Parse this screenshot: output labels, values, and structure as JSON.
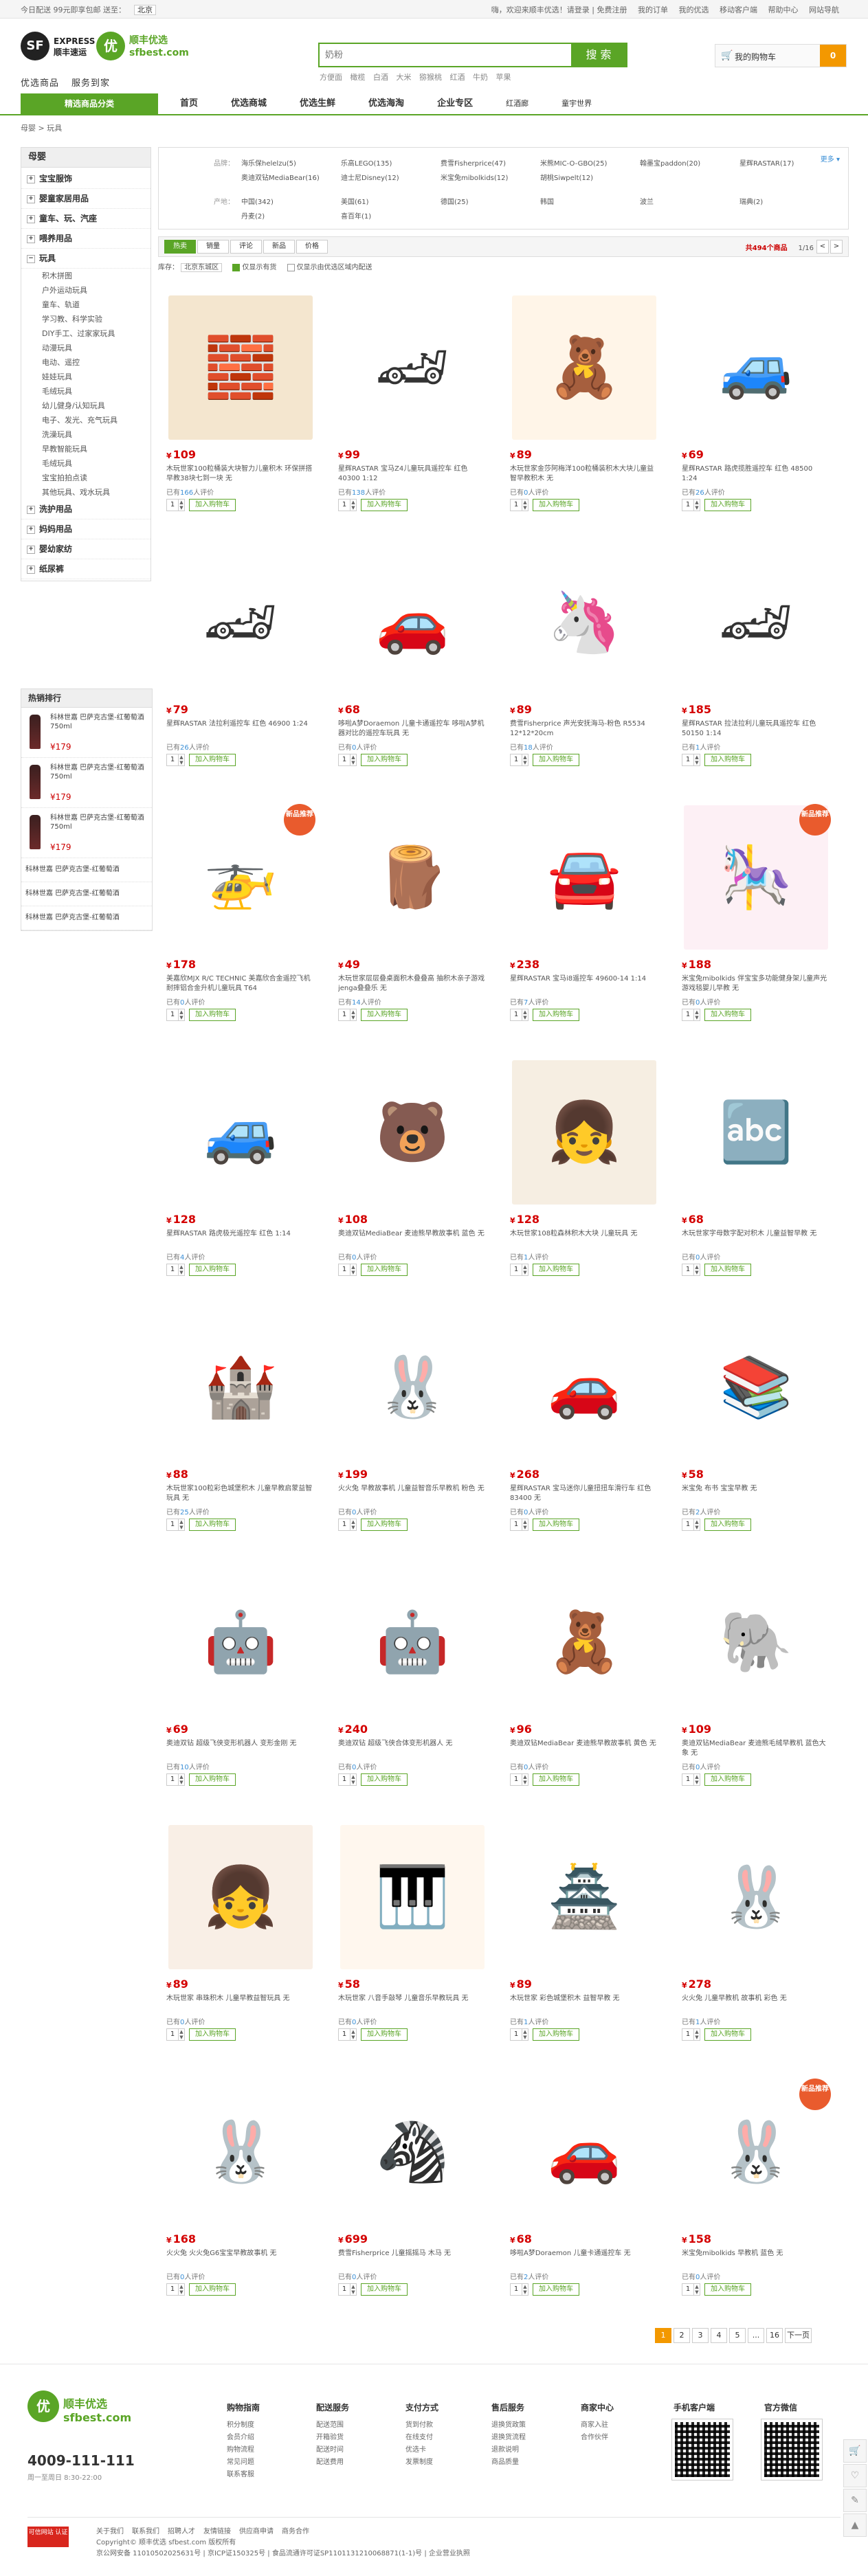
{
  "topbar": {
    "location_notice": "今日配送 99元即享包邮 送至：",
    "location": "北京",
    "greeting": "嗨，欢迎来顺丰优选！请登录 | 免费注册",
    "links": [
      "我的订单",
      "我的优选",
      "移动客户端",
      "帮助中心",
      "网站导航"
    ]
  },
  "header": {
    "sf_logo_mark": "SF",
    "sf_logo_text": "EXPRESS 顺丰速运",
    "yx_logo_mark": "优",
    "yx_logo_text": "顺丰优选 sfbest.com",
    "slogan": [
      "优选商品",
      "服务到家"
    ],
    "search_placeholder": "奶粉",
    "search_button": "搜 索",
    "hot_words": [
      "方便面",
      "橄榄",
      "白酒",
      "大米",
      "猕猴桃",
      "红酒",
      "牛奶",
      "苹果"
    ],
    "cart_label": "我的购物车",
    "cart_count": "0"
  },
  "nav": {
    "category_button": "精选商品分类",
    "items": [
      "首页",
      "优选商城",
      "优选生鲜",
      "优选海淘",
      "企业专区"
    ],
    "small_items": [
      "红酒廊",
      "童宇世界"
    ]
  },
  "breadcrumb": "母婴 > 玩具",
  "sidebar": {
    "title": "母婴",
    "groups": [
      {
        "label": "宝宝服饰",
        "expanded": false
      },
      {
        "label": "婴童家居用品",
        "expanded": false
      },
      {
        "label": "童车、玩、汽座",
        "expanded": false
      },
      {
        "label": "喂养用品",
        "expanded": false
      },
      {
        "label": "玩具",
        "expanded": true,
        "sub": [
          "积木拼图",
          "户外运动玩具",
          "童车、轨道",
          "学习教、科学实验",
          "DIY手工、过家家玩具",
          "动漫玩具",
          "电动、遥控",
          "娃娃玩具",
          "毛绒玩具",
          "幼儿健身/认知玩具",
          "电子、发光、充气玩具",
          "洗澡玩具",
          "早教智能玩具",
          "毛绒玩具",
          "宝宝拍拍点读",
          "其他玩具、戏水玩具"
        ]
      },
      {
        "label": "洗护用品",
        "expanded": false
      },
      {
        "label": "妈妈用品",
        "expanded": false
      },
      {
        "label": "婴幼家纺",
        "expanded": false
      },
      {
        "label": "纸尿裤",
        "expanded": false
      }
    ]
  },
  "ranking": {
    "title": "热销排行",
    "items": [
      {
        "title": "科林世嘉 巴萨克古堡-红葡萄酒 750ml",
        "price": "179"
      },
      {
        "title": "科林世嘉 巴萨克古堡-红葡萄酒 750ml",
        "price": "179"
      },
      {
        "title": "科林世嘉 巴萨克古堡-红葡萄酒 750ml",
        "price": "179"
      }
    ],
    "text_items": [
      "科林世嘉 巴萨克古堡-红葡萄酒",
      "科林世嘉 巴萨克古堡-红葡萄酒",
      "科林世嘉 巴萨克古堡-红葡萄酒"
    ]
  },
  "filters": {
    "brand_label": "品牌：",
    "brands": [
      "海乐保helelzu(5)",
      "乐高LEGO(135)",
      "费雪Fisherprice(47)",
      "米熊MIC-O-GBO(25)",
      "翰墨宝paddon(20)",
      "星辉RASTAR(17)",
      "奥迪双钻MediaBear(16)",
      "迪士尼Disney(12)",
      "米宝兔mibolkids(12)",
      "胡桃Siwpelt(12)"
    ],
    "origin_label": "产地：",
    "origins": [
      "中国(342)",
      "美国(61)",
      "德国(25)",
      "韩国",
      "波兰",
      "瑞典(2)",
      "丹麦(2)",
      "喜百年(1)"
    ],
    "more": "更多 ▾"
  },
  "sortbar": {
    "tabs": [
      "热卖",
      "销量",
      "评论",
      "新品",
      "价格"
    ],
    "result_text": "共494个商品",
    "page_text": "1/16",
    "prev": "<",
    "next": ">"
  },
  "subbar": {
    "stock_label": "库存：",
    "region": "北京东城区",
    "opt1": "仅显示有货",
    "opt2": "仅显示由优选区域内配送"
  },
  "products": [
    {
      "price": "109",
      "title": "木玩世家100粒桶装大块智力儿童积木 环保拼搭早教38块七到一块 无",
      "reviews": "166",
      "glyph": "🧱",
      "bg": "#f4e6cf"
    },
    {
      "price": "99",
      "title": "星辉RASTAR 宝马Z4儿童玩具遥控车 红色40300 1:12",
      "reviews": "138",
      "glyph": "🏎",
      "bg": "#ffffff"
    },
    {
      "price": "89",
      "title": "木玩世家金莎阿梅洋100粒桶装积木大块儿童益智早教积木 无",
      "reviews": "0",
      "glyph": "🧸",
      "bg": "#fff5e8"
    },
    {
      "price": "69",
      "title": "星辉RASTAR 路虎揽胜遥控车 红色 48500 1:24",
      "reviews": "26",
      "glyph": "🚙",
      "bg": "#ffffff"
    },
    {
      "price": "79",
      "title": "星辉RASTAR 法拉利遥控车 红色 46900 1:24",
      "reviews": "26",
      "glyph": "🏎",
      "bg": "#ffffff"
    },
    {
      "price": "68",
      "title": "哆啦A梦Doraemon 儿童卡通遥控车 哆啦A梦机器对比的遥控车玩具 无",
      "reviews": "0",
      "glyph": "🚗",
      "bg": "#ffffff"
    },
    {
      "price": "89",
      "title": "费雪Fisherprice 声光安抚海马-粉色 R5534 12*12*20cm",
      "reviews": "18",
      "glyph": "🦄",
      "bg": "#ffffff"
    },
    {
      "price": "185",
      "title": "星辉RASTAR 拉法拉利儿童玩具遥控车 红色50150 1:14",
      "reviews": "1",
      "glyph": "🏎",
      "bg": "#ffffff"
    },
    {
      "price": "178",
      "title": "美嘉欣MJX R/C TECHNIC 美嘉欣合金遥控飞机耐摔铝合金升机儿童玩具 T64",
      "reviews": "0",
      "glyph": "🚁",
      "bg": "#ffffff",
      "badge": "新品推荐"
    },
    {
      "price": "49",
      "title": "木玩世家层层叠桌面积木叠叠高 抽积木亲子游戏 jenga叠叠乐 无",
      "reviews": "14",
      "glyph": "🪵",
      "bg": "#ffffff"
    },
    {
      "price": "238",
      "title": "星辉RASTAR 宝马i8遥控车 49600-14 1:14",
      "reviews": "7",
      "glyph": "🚘",
      "bg": "#ffffff"
    },
    {
      "price": "188",
      "title": "米宝兔mibolkids 伴宝宝多功能健身架儿童声光游戏毯婴儿早教 无",
      "reviews": "0",
      "glyph": "🎠",
      "bg": "#fdf0f5",
      "badge": "新品推荐"
    },
    {
      "price": "128",
      "title": "星辉RASTAR 路虎极光遥控车 红色 1:14",
      "reviews": "4",
      "glyph": "🚙",
      "bg": "#ffffff"
    },
    {
      "price": "108",
      "title": "奥迪双钻MediaBear 麦迪熊早教故事机 蓝色 无",
      "reviews": "0",
      "glyph": "🐻",
      "bg": "#ffffff"
    },
    {
      "price": "128",
      "title": "木玩世家108粒森林积木大块 儿童玩具 无",
      "reviews": "1",
      "glyph": "👧",
      "bg": "#f6eee2"
    },
    {
      "price": "68",
      "title": "木玩世家字母数字配对积木 儿童益智早教 无",
      "reviews": "0",
      "glyph": "🔤",
      "bg": "#ffffff"
    },
    {
      "price": "88",
      "title": "木玩世家100粒彩色城堡积木 儿童早教启蒙益智玩具 无",
      "reviews": "25",
      "glyph": "🏰",
      "bg": "#ffffff"
    },
    {
      "price": "199",
      "title": "火火兔 早教故事机 儿童益智音乐早教机 粉色 无",
      "reviews": "0",
      "glyph": "🐰",
      "bg": "#ffffff"
    },
    {
      "price": "268",
      "title": "星辉RASTAR 宝马迷你儿童扭扭车滑行车 红色83400 无",
      "reviews": "0",
      "glyph": "🚗",
      "bg": "#ffffff"
    },
    {
      "price": "58",
      "title": "米宝兔 布书 宝宝早教 无",
      "reviews": "2",
      "glyph": "📚",
      "bg": "#ffffff"
    },
    {
      "price": "69",
      "title": "奥迪双钻 超级飞侠变形机器人 变形金刚 无",
      "reviews": "10",
      "glyph": "🤖",
      "bg": "#ffffff"
    },
    {
      "price": "240",
      "title": "奥迪双钻 超级飞侠合体变形机器人 无",
      "reviews": "0",
      "glyph": "🤖",
      "bg": "#ffffff"
    },
    {
      "price": "96",
      "title": "奥迪双钻MediaBear 麦迪熊早教故事机 黄色 无",
      "reviews": "0",
      "glyph": "🧸",
      "bg": "#ffffff"
    },
    {
      "price": "109",
      "title": "奥迪双钻MediaBear 麦迪熊毛绒早教机 蓝色大象 无",
      "reviews": "0",
      "glyph": "🐘",
      "bg": "#ffffff"
    },
    {
      "price": "89",
      "title": "木玩世家 串珠积木 儿童早教益智玩具 无",
      "reviews": "0",
      "glyph": "👧",
      "bg": "#f9efe6"
    },
    {
      "price": "58",
      "title": "木玩世家 八音手敲琴 儿童音乐早教玩具 无",
      "reviews": "0",
      "glyph": "🎹",
      "bg": "#fff7ee"
    },
    {
      "price": "89",
      "title": "木玩世家 彩色城堡积木 益智早教 无",
      "reviews": "1",
      "glyph": "🏯",
      "bg": "#ffffff"
    },
    {
      "price": "278",
      "title": "火火兔 儿童早教机 故事机 彩色 无",
      "reviews": "1",
      "glyph": "🐰",
      "bg": "#ffffff"
    },
    {
      "price": "168",
      "title": "火火兔 火火兔G6宝宝早教故事机 无",
      "reviews": "0",
      "glyph": "🐰",
      "bg": "#ffffff"
    },
    {
      "price": "699",
      "title": "费雪Fisherprice 儿童摇摇马 木马 无",
      "reviews": "0",
      "glyph": "🦓",
      "bg": "#ffffff"
    },
    {
      "price": "68",
      "title": "哆啦A梦Doraemon 儿童卡通遥控车 无",
      "reviews": "2",
      "glyph": "🚗",
      "bg": "#ffffff"
    },
    {
      "price": "158",
      "title": "米宝兔mibolkids 早教机 蓝色 无",
      "reviews": "0",
      "glyph": "🐰",
      "bg": "#ffffff",
      "badge": "新品推荐"
    }
  ],
  "buy": {
    "qty": "1",
    "add_label": "加入购物车",
    "review_prefix": "已有",
    "review_suffix": "人评价"
  },
  "pager": {
    "pages": [
      "1",
      "2",
      "3",
      "4",
      "5",
      "...",
      "16"
    ],
    "next": "下一页"
  },
  "footer": {
    "logo_mark": "优",
    "logo_text": "顺丰优选 sfbest.com",
    "phone": "4009-111-111",
    "hours": "周一至周日 8:30-22:00",
    "columns": [
      {
        "h": "购物指南",
        "items": [
          "积分制度",
          "会员介绍",
          "购物流程",
          "常见问题",
          "联系客服"
        ]
      },
      {
        "h": "配送服务",
        "items": [
          "配送范围",
          "开箱验货",
          "配送时间",
          "配送费用"
        ]
      },
      {
        "h": "支付方式",
        "items": [
          "货到付款",
          "在线支付",
          "优选卡",
          "发票制度"
        ]
      },
      {
        "h": "售后服务",
        "items": [
          "退换货政策",
          "退换货流程",
          "退款说明",
          "商品质量"
        ]
      },
      {
        "h": "商家中心",
        "items": [
          "商家入驻",
          "合作伙伴"
        ]
      }
    ],
    "qr1": "手机客户端",
    "qr2": "官方微信",
    "badge": "可信网站 认证",
    "links": [
      "关于我们",
      "联系我们",
      "招聘人才",
      "友情链接",
      "供应商申请",
      "商务合作"
    ],
    "copyright": "Copyright© 顺丰优选 sfbest.com 版权所有",
    "icp": "京公网安备 11010502025631号 | 京ICP证150325号 | 食品流通许可证SP1101131210068871(1-1)号 | 企业营业执照"
  }
}
